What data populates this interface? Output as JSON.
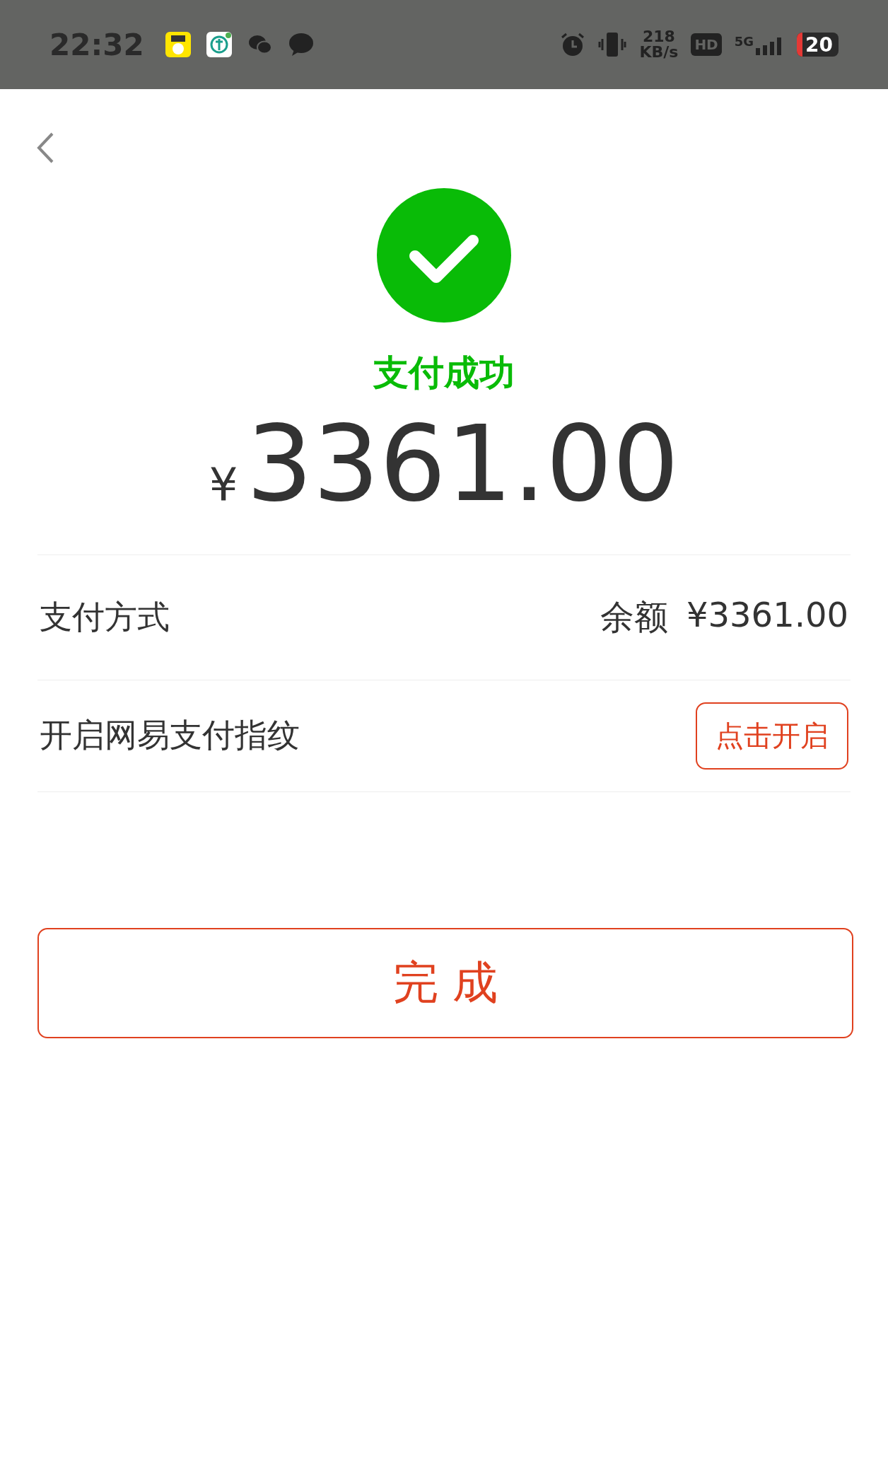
{
  "status_bar": {
    "time": "22:32",
    "speed_value": "218",
    "speed_unit": "KB/s",
    "hd": "HD",
    "network": "5G",
    "battery": "20"
  },
  "result": {
    "title": "支付成功",
    "currency": "¥",
    "amount": "3361.00"
  },
  "rows": [
    {
      "kind": "info",
      "label": "支付方式",
      "value_label": "余额",
      "value": "¥3361.00"
    },
    {
      "kind": "action",
      "label": "开启网易支付指纹",
      "action": "点击开启"
    }
  ],
  "done_button": "完 成"
}
